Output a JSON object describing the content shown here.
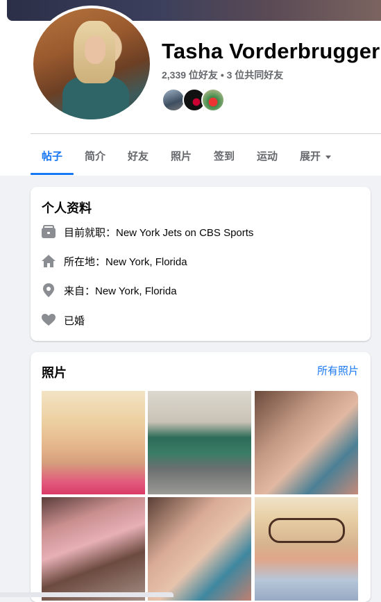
{
  "profile": {
    "name": "Tasha Vorderbrugger",
    "friends_line": "2,339 位好友 • 3 位共同好友"
  },
  "tabs": [
    {
      "label": "帖子",
      "active": true
    },
    {
      "label": "简介"
    },
    {
      "label": "好友"
    },
    {
      "label": "照片"
    },
    {
      "label": "签到"
    },
    {
      "label": "运动"
    },
    {
      "label": "展开"
    }
  ],
  "intro": {
    "title": "个人资料",
    "items": [
      {
        "icon": "briefcase-icon",
        "text": "目前就职：New York Jets on CBS Sports"
      },
      {
        "icon": "home-icon",
        "text": "所在地：New York, Florida"
      },
      {
        "icon": "location-pin-icon",
        "text": "来自：New York, Florida"
      },
      {
        "icon": "heart-icon",
        "text": "已婚"
      }
    ]
  },
  "photos": {
    "title": "照片",
    "all_link": "所有照片"
  },
  "colors": {
    "accent": "#1877f2",
    "secondary_text": "#65676b",
    "background": "#f0f2f5"
  }
}
